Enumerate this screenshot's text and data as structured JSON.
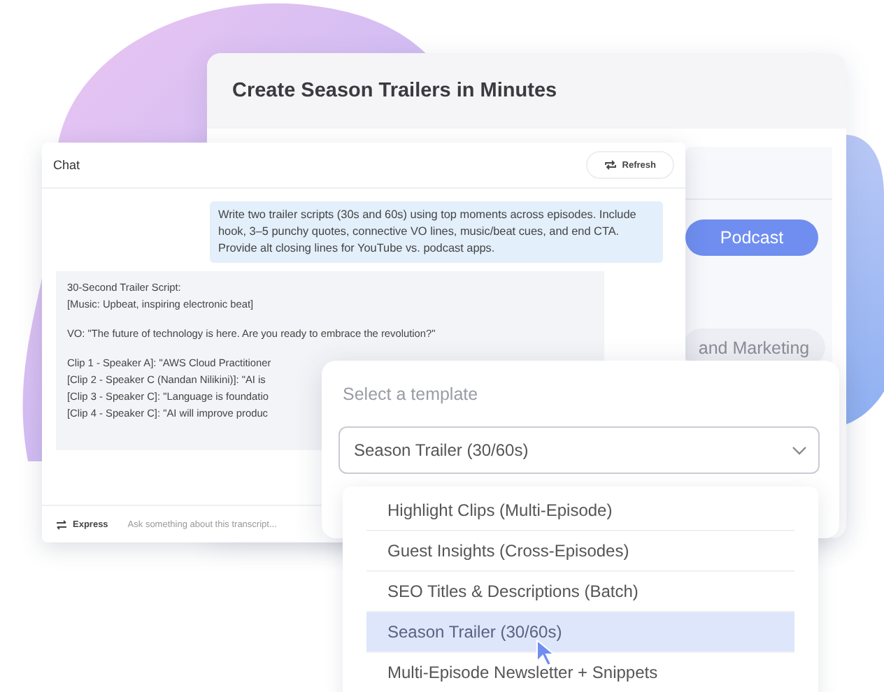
{
  "back_card": {
    "title": "Create Season Trailers in Minutes",
    "chips": [
      {
        "label": "Podcast",
        "selected": true
      },
      {
        "label": "and Marketing",
        "selected": false
      }
    ]
  },
  "chat": {
    "title": "Chat",
    "refresh_button": "Refresh",
    "user_message": "Write two trailer scripts (30s and 60s) using top moments across episodes. Include hook, 3–5 punchy quotes, connective VO lines, music/beat cues, and end CTA. Provide alt closing lines for YouTube vs. podcast apps.",
    "reply_blocks": [
      [
        "30-Second Trailer Script:",
        "[Music: Upbeat, inspiring electronic beat]"
      ],
      [
        "VO: \"The future of technology is here. Are you ready to embrace the revolution?\""
      ],
      [
        "Clip 1 - Speaker A]: \"AWS Cloud Practitioner",
        "[Clip 2 - Speaker C (Nandan Nilikini)]: \"AI is",
        "[Clip 3 - Speaker C]: \"Language is foundatio",
        "[Clip 4 - Speaker C]: \"AI will improve produc"
      ]
    ],
    "mode_button": "Express",
    "input": {
      "placeholder": "Ask something about this transcript..."
    }
  },
  "template_picker": {
    "label": "Select a template",
    "value": "Season Trailer (30/60s)",
    "options": [
      {
        "label": "Highlight Clips (Multi-Episode)",
        "selected": false
      },
      {
        "label": "Guest Insights (Cross-Episodes)",
        "selected": false
      },
      {
        "label": "SEO Titles & Descriptions (Batch)",
        "selected": false
      },
      {
        "label": "Season Trailer (30/60s)",
        "selected": true
      },
      {
        "label": "Multi-Episode Newsletter + Snippets",
        "selected": false
      }
    ]
  }
}
